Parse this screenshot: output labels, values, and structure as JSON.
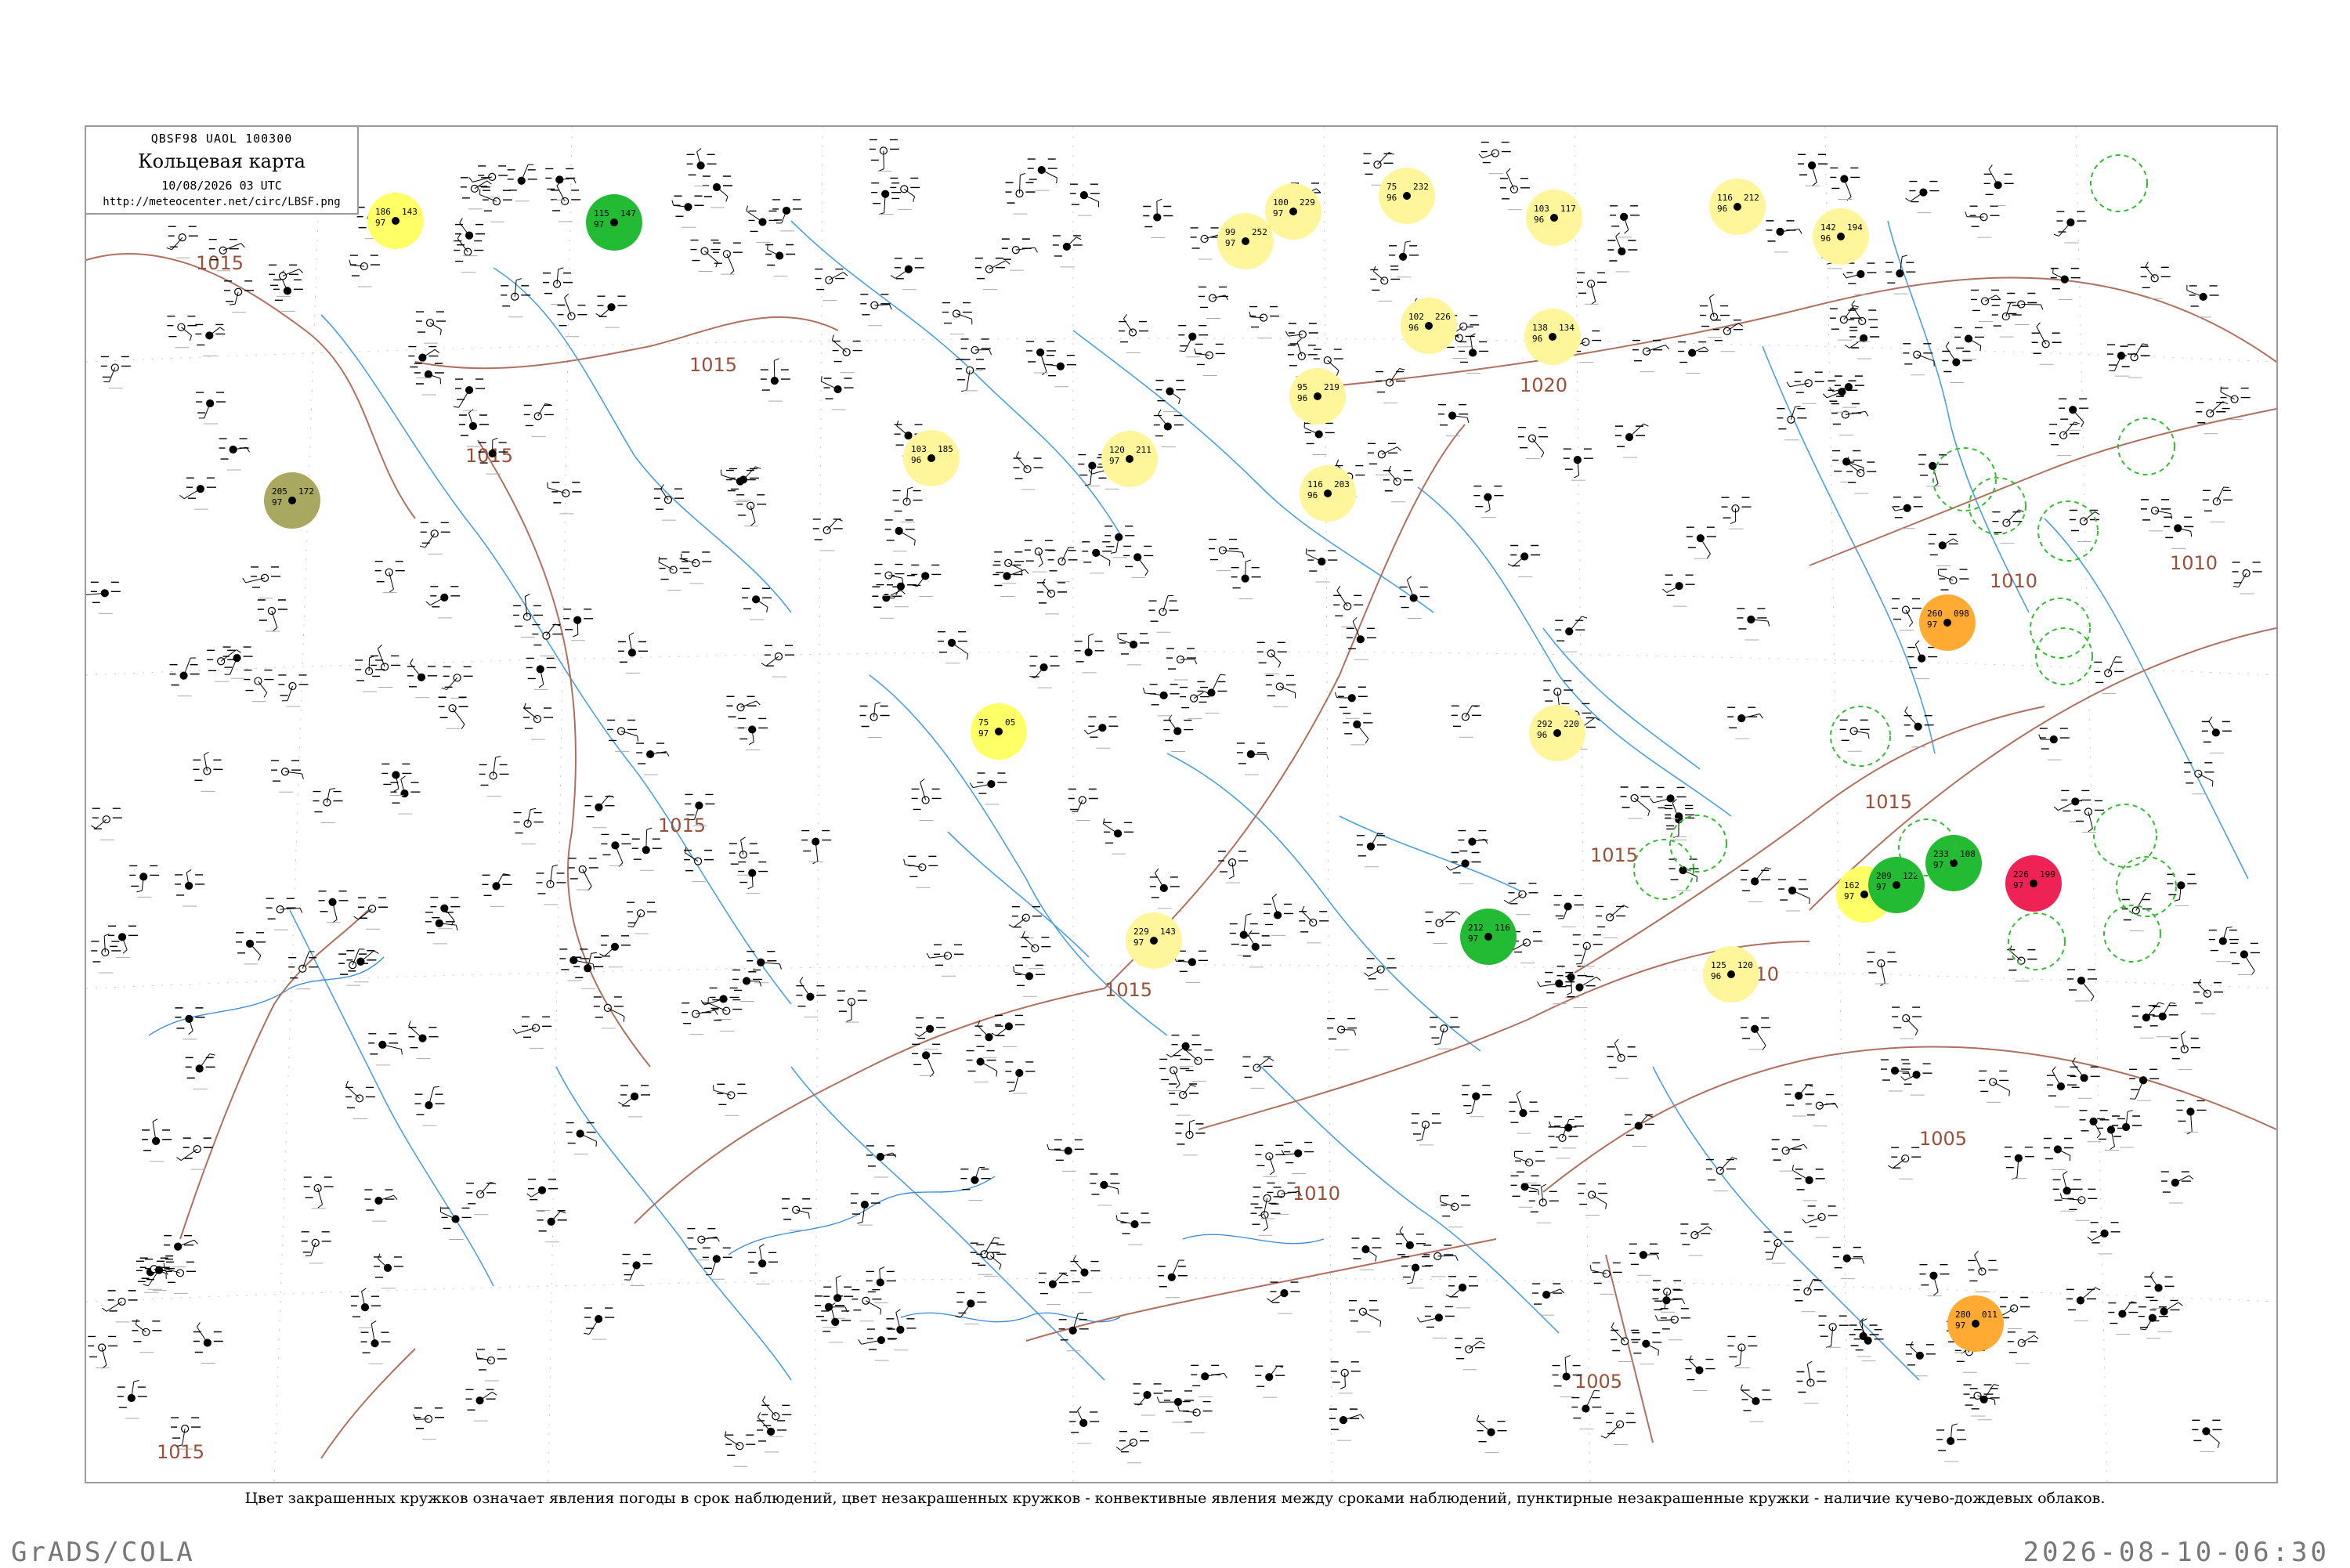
{
  "header": {
    "code": "QBSF98  UAOL  100300",
    "title": "Кольцевая карта",
    "timestamp": "10/08/2026 03 UTC",
    "url": "http://meteocenter.net/circ/LBSF.png"
  },
  "caption": "Цвет закрашенных кружков означает явления погоды в срок наблюдений, цвет незакрашенных кружков - конвективные явления между сроками наблюдений, пунктирные незакрашенные кружки - наличие кучево-дождевых облаков.",
  "footer": {
    "left": "GrADS/COLA",
    "right": "2026-08-10-06:30"
  },
  "isobars": [
    {
      "label": "1015"
    },
    {
      "label": "1015"
    },
    {
      "label": "1015"
    },
    {
      "label": "1015"
    },
    {
      "label": "1020"
    },
    {
      "label": "1015"
    },
    {
      "label": "1015"
    },
    {
      "label": "1010"
    },
    {
      "label": "1010"
    },
    {
      "label": "1010"
    },
    {
      "label": "1005"
    },
    {
      "label": "1005"
    },
    {
      "label": "1015"
    },
    {
      "label": "1015"
    },
    {
      "label": "1010"
    }
  ],
  "colors": {
    "river": "#4aa0e0",
    "isobar": "#b07060",
    "station_label": "#999999",
    "highlight_yellow": "#ffff66",
    "highlight_pale_yellow": "#fff59a",
    "highlight_green": "#22bb33",
    "highlight_orange": "#ffaa33",
    "highlight_red": "#ee2255",
    "highlight_olive": "#a8a860",
    "cb_dashed": "#33bb33"
  },
  "stations": [
    {
      "t": "186",
      "h": "97",
      "p": "143",
      "c": "yellow"
    },
    {
      "t": "115",
      "h": "97",
      "p": "147",
      "c": "green"
    },
    {
      "t": "75",
      "h": "96",
      "p": "232",
      "c": "pale"
    },
    {
      "t": "100",
      "h": "97",
      "p": "229",
      "c": "pale"
    },
    {
      "t": "99",
      "h": "97",
      "p": "252",
      "c": "pale"
    },
    {
      "t": "103",
      "h": "96",
      "p": "117",
      "c": "pale"
    },
    {
      "t": "116",
      "h": "96",
      "p": "212",
      "c": "pale"
    },
    {
      "t": "142",
      "h": "96",
      "p": "194",
      "c": "pale"
    },
    {
      "t": "138",
      "h": "96",
      "p": "134",
      "c": "pale"
    },
    {
      "t": "102",
      "h": "96",
      "p": "226",
      "c": "pale"
    },
    {
      "t": "95",
      "h": "96",
      "p": "219",
      "c": "pale"
    },
    {
      "t": "103",
      "h": "96",
      "p": "185",
      "c": "pale"
    },
    {
      "t": "120",
      "h": "97",
      "p": "211",
      "c": "pale"
    },
    {
      "t": "116",
      "h": "96",
      "p": "203",
      "c": "pale"
    },
    {
      "t": "205",
      "h": "97",
      "p": "172",
      "c": "olive"
    },
    {
      "t": "75",
      "h": "97",
      "p": "05",
      "c": "yellow"
    },
    {
      "t": "229",
      "h": "97",
      "p": "143",
      "c": "pale"
    },
    {
      "t": "292",
      "h": "96",
      "p": "220",
      "c": "pale"
    },
    {
      "t": "125",
      "h": "96",
      "p": "120",
      "c": "pale"
    },
    {
      "t": "162",
      "h": "97",
      "p": "152",
      "c": "yellow"
    },
    {
      "t": "212",
      "h": "97",
      "p": "116",
      "c": "green"
    },
    {
      "t": "233",
      "h": "97",
      "p": "108",
      "c": "green"
    },
    {
      "t": "209",
      "h": "97",
      "p": "122",
      "c": "green"
    },
    {
      "t": "226",
      "h": "97",
      "p": "199",
      "c": "red"
    },
    {
      "t": "260",
      "h": "97",
      "p": "098",
      "c": "orange"
    },
    {
      "t": "280",
      "h": "97",
      "p": "011",
      "c": "orange"
    }
  ]
}
